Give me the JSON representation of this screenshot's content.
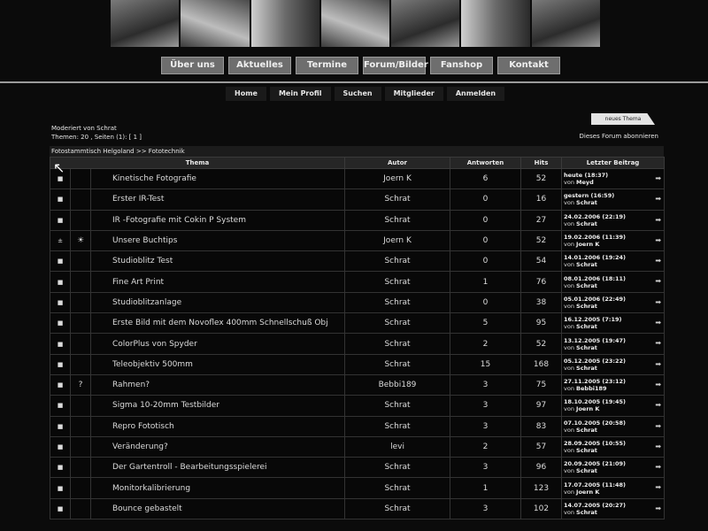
{
  "nav_main": [
    "Über uns",
    "Aktuelles",
    "Termine",
    "Forum/Bilder",
    "Fanshop",
    "Kontakt"
  ],
  "nav_sub": [
    "Home",
    "Mein Profil",
    "Suchen",
    "Mitglieder",
    "Anmelden"
  ],
  "forum": {
    "moderated": "Moderiert von Schrat",
    "topics_pages": "Themen: 20 , Seiten (1): [ 1 ]",
    "new_topic": "neues Thema",
    "subscribe": "Dieses Forum abonnieren",
    "breadcrumb": "Fotostammtisch Helgoland >> Fototechnik"
  },
  "columns": [
    "Thema",
    "Autor",
    "Antworten",
    "Hits",
    "Letzter Beitrag"
  ],
  "topics": [
    {
      "icon": "■",
      "mood": "",
      "title": "Kinetische Fotografie",
      "author": "Joern K",
      "replies": "6",
      "hits": "52",
      "last": "heute (18:37)",
      "by": "Meyd"
    },
    {
      "icon": "■",
      "mood": "",
      "title": "Erster IR-Test",
      "author": "Schrat",
      "replies": "0",
      "hits": "16",
      "last": "gestern (16:59)",
      "by": "Schrat"
    },
    {
      "icon": "■",
      "mood": "",
      "title": "IR -Fotografie mit Cokin P System",
      "author": "Schrat",
      "replies": "0",
      "hits": "27",
      "last": "24.02.2006 (22:19)",
      "by": "Schrat"
    },
    {
      "icon": "±",
      "mood": "☀",
      "title": "Unsere Buchtips",
      "author": "Joern K",
      "replies": "0",
      "hits": "52",
      "last": "19.02.2006 (11:39)",
      "by": "Joern K"
    },
    {
      "icon": "■",
      "mood": "",
      "title": "Studioblitz Test",
      "author": "Schrat",
      "replies": "0",
      "hits": "54",
      "last": "14.01.2006 (19:24)",
      "by": "Schrat"
    },
    {
      "icon": "■",
      "mood": "",
      "title": "Fine Art Print",
      "author": "Schrat",
      "replies": "1",
      "hits": "76",
      "last": "08.01.2006 (18:11)",
      "by": "Schrat"
    },
    {
      "icon": "■",
      "mood": "",
      "title": "Studioblitzanlage",
      "author": "Schrat",
      "replies": "0",
      "hits": "38",
      "last": "05.01.2006 (22:49)",
      "by": "Schrat"
    },
    {
      "icon": "■",
      "mood": "",
      "title": "Erste Bild mit dem Novoflex 400mm Schnellschuß Obj",
      "author": "Schrat",
      "replies": "5",
      "hits": "95",
      "last": "16.12.2005 (7:19)",
      "by": "Schrat"
    },
    {
      "icon": "■",
      "mood": "",
      "title": "ColorPlus von Spyder",
      "author": "Schrat",
      "replies": "2",
      "hits": "52",
      "last": "13.12.2005 (19:47)",
      "by": "Schrat"
    },
    {
      "icon": "■",
      "mood": "",
      "title": "Teleobjektiv 500mm",
      "author": "Schrat",
      "replies": "15",
      "hits": "168",
      "last": "05.12.2005 (23:22)",
      "by": "Schrat"
    },
    {
      "icon": "■",
      "mood": "?",
      "title": "Rahmen?",
      "author": "Bebbi189",
      "replies": "3",
      "hits": "75",
      "last": "27.11.2005 (23:12)",
      "by": "Bebbi189"
    },
    {
      "icon": "■",
      "mood": "",
      "title": "Sigma 10-20mm Testbilder",
      "author": "Schrat",
      "replies": "3",
      "hits": "97",
      "last": "18.10.2005 (19:45)",
      "by": "Joern K"
    },
    {
      "icon": "■",
      "mood": "",
      "title": "Repro Fototisch",
      "author": "Schrat",
      "replies": "3",
      "hits": "83",
      "last": "07.10.2005 (20:58)",
      "by": "Schrat"
    },
    {
      "icon": "■",
      "mood": "",
      "title": "Veränderung?",
      "author": "levi",
      "replies": "2",
      "hits": "57",
      "last": "28.09.2005 (10:55)",
      "by": "Schrat"
    },
    {
      "icon": "■",
      "mood": "",
      "title": "Der Gartentroll - Bearbeitungsspielerei",
      "author": "Schrat",
      "replies": "3",
      "hits": "96",
      "last": "20.09.2005 (21:09)",
      "by": "Schrat"
    },
    {
      "icon": "■",
      "mood": "",
      "title": "Monitorkalibrierung",
      "author": "Schrat",
      "replies": "1",
      "hits": "123",
      "last": "17.07.2005 (11:48)",
      "by": "Joern K"
    },
    {
      "icon": "■",
      "mood": "",
      "title": "Bounce gebastelt",
      "author": "Schrat",
      "replies": "3",
      "hits": "102",
      "last": "14.07.2005 (20:27)",
      "by": "Schrat"
    }
  ],
  "von": "von",
  "arrow_glyph": "➡",
  "cursor_glyph": "↖"
}
